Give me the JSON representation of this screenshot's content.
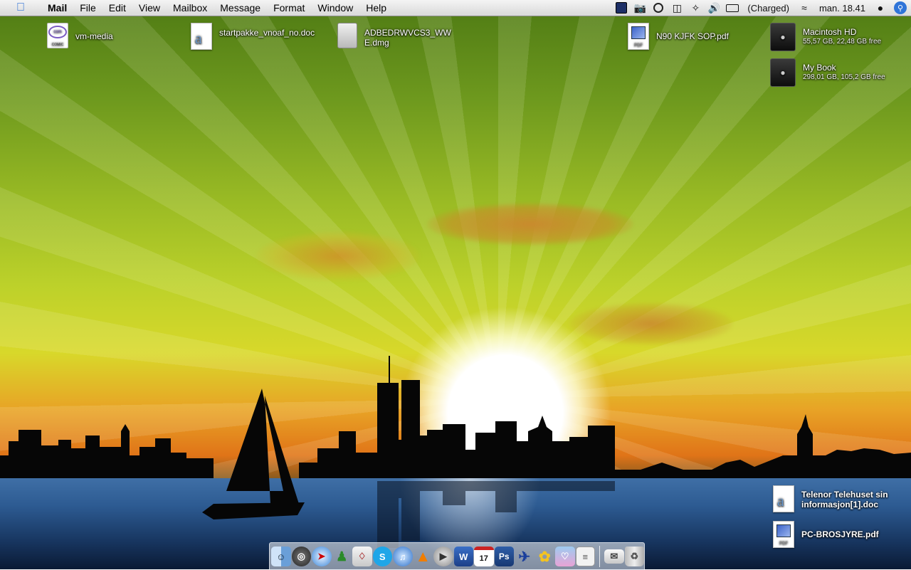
{
  "menubar": {
    "apple_icon": "apple-icon",
    "app_name": "Mail",
    "items": [
      "File",
      "Edit",
      "View",
      "Mailbox",
      "Message",
      "Format",
      "Window",
      "Help"
    ],
    "battery_status": "(Charged)",
    "clock": "man. 18.41"
  },
  "desktop_icons": {
    "vm_media": {
      "label": "vm-media"
    },
    "startpakke": {
      "label": "startpakke_vnoaf_no.doc"
    },
    "adbe": {
      "label": "ADBEDRWVCS3_WWE.dmg"
    },
    "n90": {
      "label": "N90 KJFK SOP.pdf"
    },
    "macintosh_hd": {
      "label": "Macintosh HD",
      "info": "55,57 GB, 22,48 GB free"
    },
    "my_book": {
      "label": "My Book",
      "info": "298,01 GB, 105,2 GB free"
    },
    "telenor": {
      "label": "Telenor Telehuset sin informasjon[1].doc"
    },
    "pc_brosjyre": {
      "label": "PC-BROSJYRE.pdf"
    }
  },
  "dock": {
    "items": [
      "Finder",
      "Dashboard",
      "Safari",
      "Messenger",
      "Preview",
      "Skype",
      "iTunes",
      "VLC",
      "QuickTime",
      "Word",
      "iCal",
      "Photoshop",
      "Mail",
      "Flower",
      "Notes",
      "Downloads",
      "Trash"
    ],
    "ical_date": "17",
    "photoshop_label": "Ps"
  },
  "colors": {
    "menubar": "#e6e6e6",
    "spotlight": "#2f74d8",
    "sky_top": "#4e7a14",
    "horizon": "#e07418",
    "water": "#20426e"
  }
}
